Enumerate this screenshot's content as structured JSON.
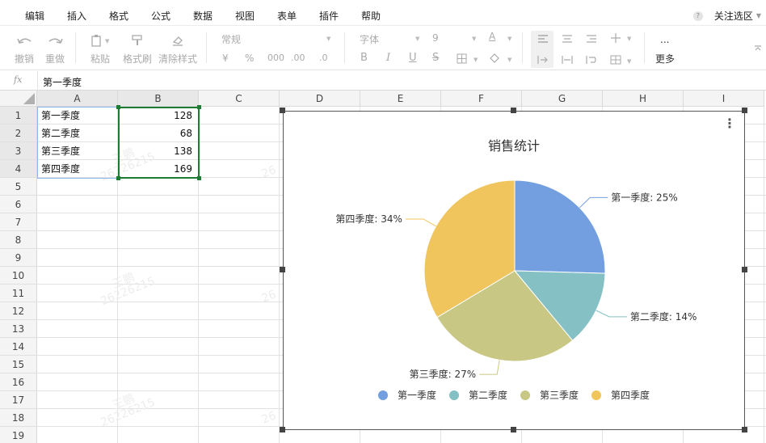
{
  "menu": [
    "编辑",
    "插入",
    "格式",
    "公式",
    "数据",
    "视图",
    "表单",
    "插件",
    "帮助"
  ],
  "follow_selection": "关注选区",
  "help_glyph": "?",
  "toolbar": {
    "undo": "撤销",
    "redo": "重做",
    "paste": "粘贴",
    "format_painter": "格式刷",
    "clear_format": "清除样式",
    "number_format": "常规",
    "currency": "¥",
    "percent": "%",
    "thousands": "000",
    "dec_inc": ".00",
    "dec_dec": ".0",
    "font": "字体",
    "font_size": "9",
    "text_color": "A",
    "bold": "B",
    "italic": "I",
    "underline": "U",
    "strike": "S",
    "more_dots": "...",
    "more": "更多",
    "icons": [
      "undo-icon",
      "redo-icon",
      "paste-icon",
      "format-painter-icon",
      "eraser-icon",
      "border-icon",
      "fill-color-icon",
      "align-left-icon",
      "align-center-icon",
      "align-right-icon",
      "valign-icon",
      "indent-icon",
      "merge-icon",
      "wrap-icon",
      "merge-cells-icon",
      "collapse-icon"
    ]
  },
  "formula": {
    "fx": "fx",
    "value": "第一季度"
  },
  "columns": [
    "A",
    "B",
    "C",
    "D",
    "E",
    "F",
    "G",
    "H",
    "I"
  ],
  "rows": [
    "1",
    "2",
    "3",
    "4",
    "5",
    "6",
    "7",
    "8",
    "9",
    "10",
    "11",
    "12",
    "13",
    "14",
    "15",
    "16",
    "17",
    "18",
    "19"
  ],
  "cells": [
    {
      "label": "第一季度",
      "value": "128"
    },
    {
      "label": "第二季度",
      "value": "68"
    },
    {
      "label": "第三季度",
      "value": "138"
    },
    {
      "label": "第四季度",
      "value": "169"
    }
  ],
  "watermark": {
    "name": "王鹏",
    "id": "26226215",
    "id_partial": "26"
  },
  "colors": {
    "selection_green": "#1e7b34",
    "selection_blue": "#8fb4e8",
    "q1": "#739fe0",
    "q2": "#84c0c4",
    "q3": "#c9c784",
    "q4": "#f0c55e"
  },
  "chart_data": {
    "type": "pie",
    "title": "销售统计",
    "categories": [
      "第一季度",
      "第二季度",
      "第三季度",
      "第四季度"
    ],
    "values": [
      128,
      68,
      138,
      169
    ],
    "data_labels": [
      "第一季度: 25%",
      "第二季度: 14%",
      "第三季度: 27%",
      "第四季度: 34%"
    ],
    "colors": [
      "#739fe0",
      "#84c0c4",
      "#c9c784",
      "#f0c55e"
    ],
    "legend": {
      "position": "bottom",
      "entries": [
        "第一季度",
        "第二季度",
        "第三季度",
        "第四季度"
      ]
    },
    "menu_glyph": "⋮"
  }
}
